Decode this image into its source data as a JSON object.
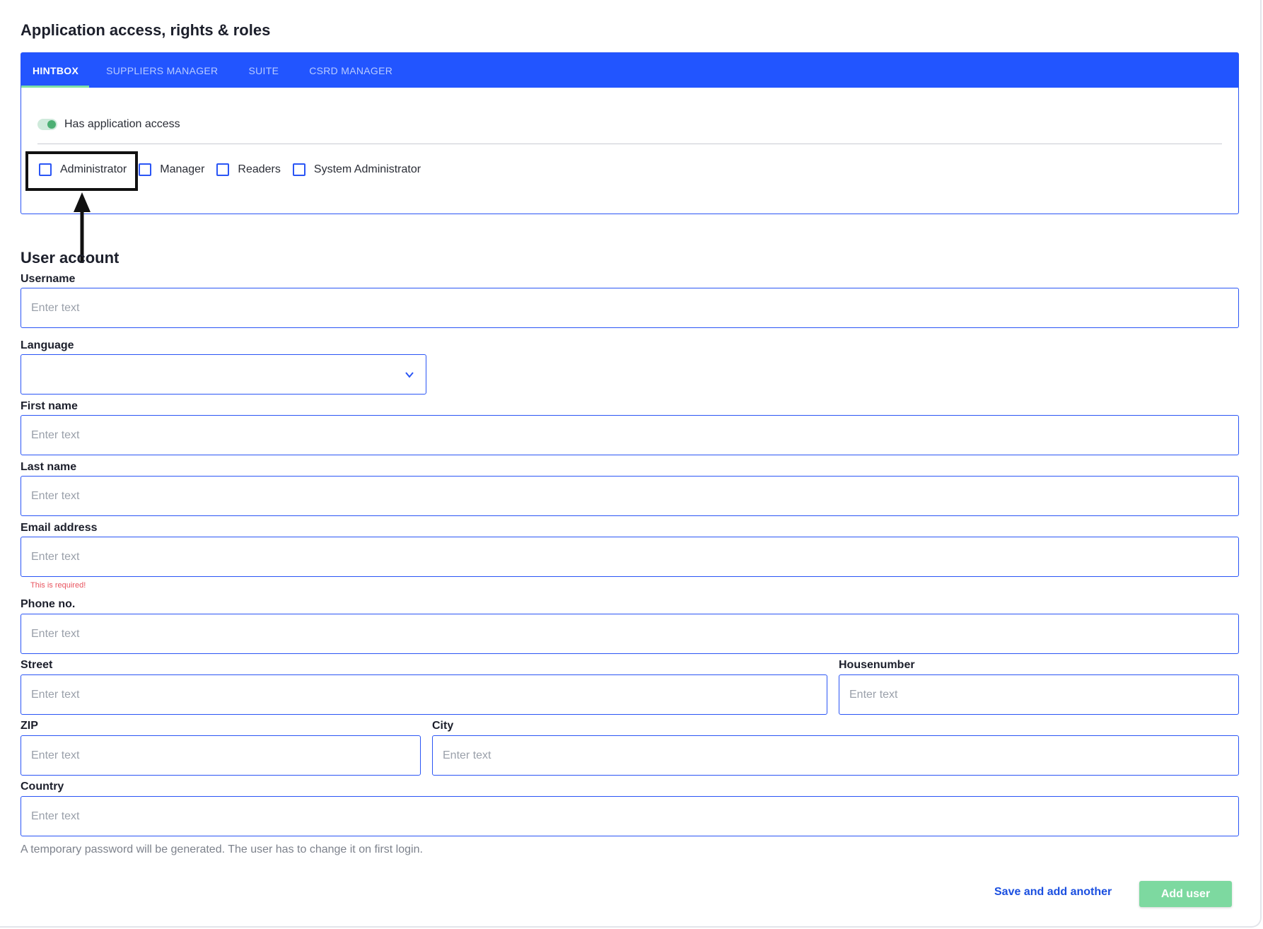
{
  "access": {
    "title": "Application access, rights & roles",
    "tabs": [
      {
        "label": "HINTBOX",
        "active": true
      },
      {
        "label": "SUPPLIERS MANAGER",
        "active": false
      },
      {
        "label": "SUITE",
        "active": false
      },
      {
        "label": "CSRD MANAGER",
        "active": false
      }
    ],
    "toggle_label": "Has application access",
    "toggle_on": true,
    "roles": [
      {
        "label": "Administrator",
        "checked": false
      },
      {
        "label": "Manager",
        "checked": false
      },
      {
        "label": "Readers",
        "checked": false
      },
      {
        "label": "System Administrator",
        "checked": false
      }
    ]
  },
  "user": {
    "title": "User account",
    "placeholder": "Enter text",
    "fields": {
      "username": {
        "label": "Username",
        "value": ""
      },
      "language": {
        "label": "Language",
        "value": ""
      },
      "first_name": {
        "label": "First name",
        "value": ""
      },
      "last_name": {
        "label": "Last name",
        "value": ""
      },
      "email": {
        "label": "Email address",
        "value": "",
        "error": "This is required!"
      },
      "phone": {
        "label": "Phone no.",
        "value": ""
      },
      "street": {
        "label": "Street",
        "value": ""
      },
      "housenumber": {
        "label": "Housenumber",
        "value": ""
      },
      "zip": {
        "label": "ZIP",
        "value": ""
      },
      "city": {
        "label": "City",
        "value": ""
      },
      "country": {
        "label": "Country",
        "value": ""
      }
    },
    "password_hint": "A temporary password will be generated. The user has to change it on first login."
  },
  "actions": {
    "save_add_another": "Save and add another",
    "add_user": "Add user"
  },
  "colors": {
    "primary": "#2255ff",
    "success": "#7dd9a0",
    "error": "#e8535e"
  }
}
